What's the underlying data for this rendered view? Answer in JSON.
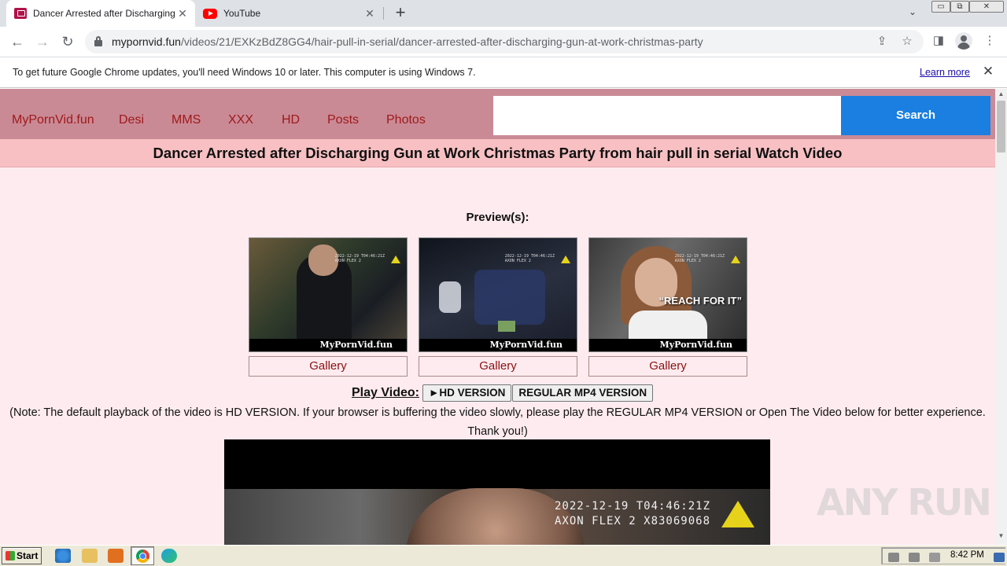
{
  "browser": {
    "tabs": [
      {
        "title": "Dancer Arrested after Discharging Gun at Work Christmas Party",
        "favicon": "site-favicon",
        "active": true
      },
      {
        "title": "YouTube",
        "favicon": "youtube-favicon",
        "active": false
      }
    ],
    "new_tab_label": "+",
    "tab_search_icon": "⌄",
    "window_buttons": {
      "minimize": "▭",
      "restore": "⧉",
      "close": "✕"
    },
    "url_domain": "mypornvid.fun",
    "url_path": "/videos/21/EXKzBdZ8GG4/hair-pull-in-serial/dancer-arrested-after-discharging-gun-at-work-christmas-party",
    "toolbar_icons": {
      "back": "←",
      "forward": "→",
      "reload": "↻",
      "share": "⇪",
      "bookmark": "☆",
      "sidebar": "◨",
      "menu": "⋮"
    }
  },
  "infobar": {
    "message": "To get future Google Chrome updates, you'll need Windows 10 or later. This computer is using Windows 7.",
    "link": "Learn more",
    "close": "✕"
  },
  "site": {
    "nav": [
      "MyPornVid.fun",
      "Desi",
      "MMS",
      "XXX",
      "HD",
      "Posts",
      "Photos"
    ],
    "search_placeholder": "",
    "search_button": "Search",
    "page_title": "Dancer Arrested after Discharging Gun at Work Christmas Party from hair pull in serial Watch Video",
    "previews_heading": "Preview(s):",
    "previews": [
      {
        "watermark": "MyPornVid.fun",
        "gallery": "Gallery"
      },
      {
        "watermark": "MyPornVid.fun",
        "gallery": "Gallery"
      },
      {
        "watermark": "MyPornVid.fun",
        "gallery": "Gallery",
        "caption": "“REACH FOR IT”"
      }
    ],
    "play_label": "Play Video:",
    "hd_button": "►HD VERSION",
    "mp4_button": "REGULAR MP4 VERSION",
    "note": "(Note: The default playback of the video is HD VERSION. If your browser is buffering the video slowly, please play the REGULAR MP4 VERSION or Open The Video below for better experience. Thank you!)",
    "player_overlay": {
      "line1": "2022-12-19 T04:46:21Z",
      "line2": "AXON FLEX 2 X83069068"
    }
  },
  "watermark": "ANY RUN",
  "taskbar": {
    "start": "Start",
    "clock": "8:42 PM"
  }
}
